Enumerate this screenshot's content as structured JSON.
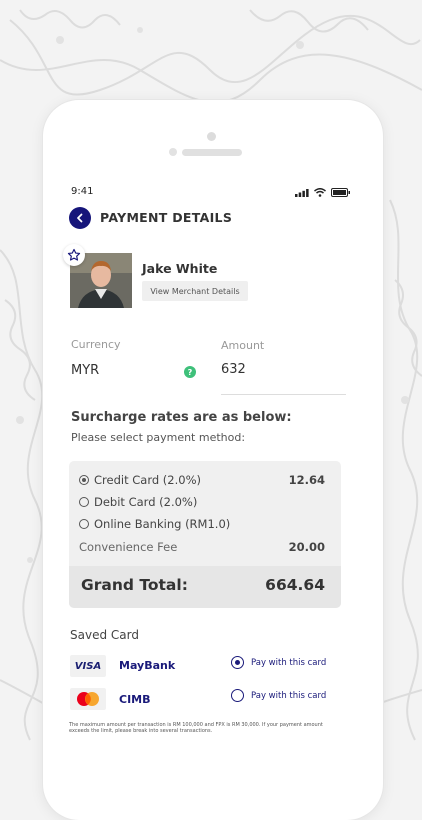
{
  "status_bar": {
    "time": "9:41"
  },
  "header": {
    "title": "PAYMENT DETAILS"
  },
  "merchant": {
    "name": "Jake White",
    "view_details_label": "View Merchant Details"
  },
  "form": {
    "currency_label": "Currency",
    "currency_value": "MYR",
    "amount_label": "Amount",
    "amount_value": "632"
  },
  "surcharge": {
    "title": "Surcharge rates are as below:",
    "subtitle": "Please select payment method:",
    "methods": [
      {
        "label": "Credit Card (2.0%)",
        "value": "12.64",
        "selected": true
      },
      {
        "label": "Debit Card (2.0%)",
        "value": "",
        "selected": false
      },
      {
        "label": "Online Banking (RM1.0)",
        "value": "",
        "selected": false
      }
    ],
    "convenience_fee_label": "Convenience Fee",
    "convenience_fee_value": "20.00",
    "grand_total_label": "Grand Total:",
    "grand_total_value": "664.64"
  },
  "saved_cards": {
    "title": "Saved Card",
    "cards": [
      {
        "logo": "VISA",
        "bank": "MayBank",
        "pay_label": "Pay with this card",
        "selected": true
      },
      {
        "logo": "mastercard",
        "bank": "CIMB",
        "pay_label": "Pay with this card",
        "selected": false
      }
    ]
  },
  "disclaimer": "The maximum amount per transaction is RM 100,000 and FPX is RM 30,000. If your payment amount exceeds the limit, please break into several transactions.",
  "colors": {
    "primary": "#16157a",
    "help": "#3ec07a",
    "box_bg": "#f0f0f0"
  }
}
